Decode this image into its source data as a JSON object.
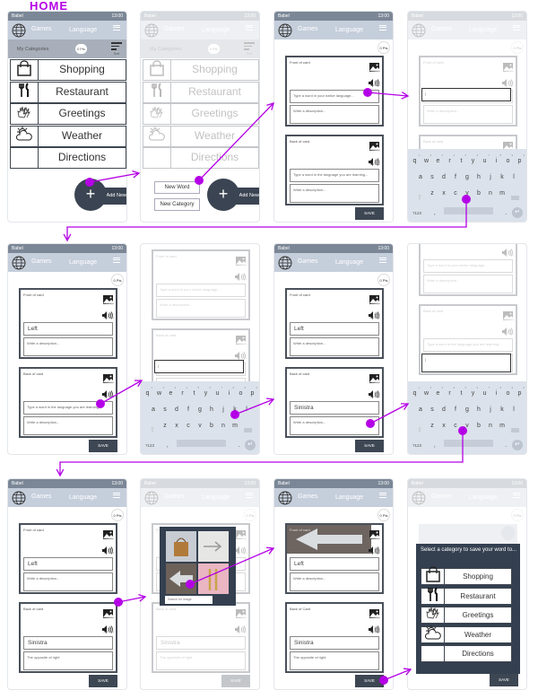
{
  "title_label": "HOME",
  "app": {
    "name": "Babel",
    "time": "13:00",
    "nav_games": "Games",
    "nav_language": "Language"
  },
  "home": {
    "my_categories": "My Categories",
    "points": "0 Pts",
    "sort": "Sort",
    "add_new": "Add New",
    "add_symbol": "+",
    "categories": [
      {
        "label": "Shopping",
        "icon": "shopping-bag-icon"
      },
      {
        "label": "Restaurant",
        "icon": "fork-knife-icon"
      },
      {
        "label": "Greetings",
        "icon": "waving-hands-icon"
      },
      {
        "label": "Weather",
        "icon": "sun-cloud-icon"
      },
      {
        "label": "Directions",
        "icon": ""
      }
    ]
  },
  "menu": {
    "new_word": "New Word",
    "new_category": "New Category"
  },
  "form": {
    "points": "0 Pts",
    "front_label": "Front of card",
    "back_label": "Back of card",
    "back_label_alt": "Back of Card",
    "add_image": "Add Image",
    "add_audio": "Add Audio",
    "native_placeholder": "Type a word in your native language...",
    "learning_placeholder": "Type a word in the language you are learning...",
    "description_placeholder": "Write a description...",
    "save": "SAVE"
  },
  "entries": {
    "front_word": "Left",
    "back_word": "Sinistra",
    "back_description": "The opposite of right"
  },
  "keyboard": {
    "row1": [
      "q",
      "w",
      "e",
      "r",
      "t",
      "y",
      "u",
      "i",
      "o",
      "p"
    ],
    "hints": [
      "1",
      "2",
      "3",
      "4",
      "5",
      "6",
      "7",
      "8",
      "9",
      "0"
    ],
    "row2": [
      "a",
      "s",
      "d",
      "f",
      "g",
      "h",
      "j",
      "k",
      "l"
    ],
    "row3": [
      "z",
      "x",
      "c",
      "v",
      "b",
      "n",
      "m"
    ],
    "symbols": "?123",
    "comma": ",",
    "period": "."
  },
  "image_picker": {
    "search_placeholder": "Search for image"
  },
  "category_dialog": {
    "prompt": "Select a category to save your word to...",
    "save": "SAVE"
  },
  "colors": {
    "flow_arrow": "#b400e6",
    "header": "#c5cedb",
    "status_bar": "#7b8796",
    "dark_panel": "#344050",
    "button": "#3d4653"
  }
}
